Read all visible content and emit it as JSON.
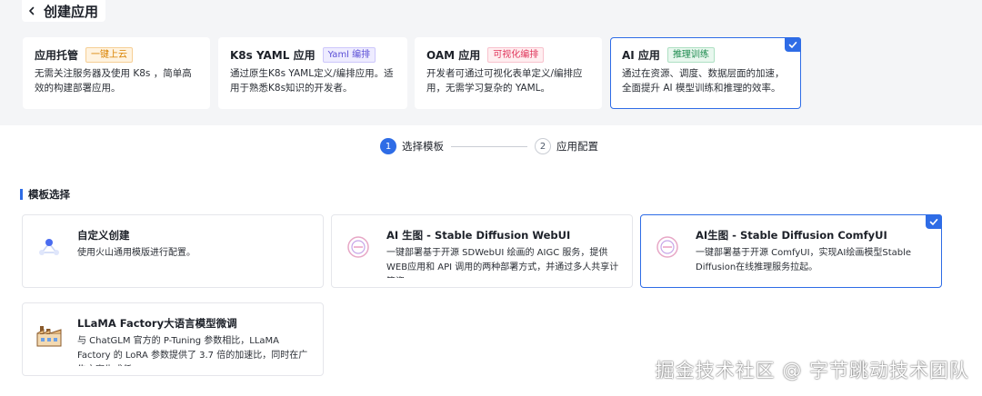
{
  "header": {
    "title": "创建应用"
  },
  "app_types": [
    {
      "name": "应用托管",
      "tag": "一键上云",
      "desc": "无需关注服务器及使用 K8s ，简单高效的构建部署应用。",
      "selected": false
    },
    {
      "name": "K8s YAML 应用",
      "tag": "Yaml 编排",
      "desc": "通过原生K8s YAML定义/编排应用。适用于熟悉K8s知识的开发者。",
      "selected": false
    },
    {
      "name": "OAM 应用",
      "tag": "可视化编排",
      "desc": "开发者可通过可视化表单定义/编排应用，无需学习复杂的 YAML。",
      "selected": false
    },
    {
      "name": "AI 应用",
      "tag": "推理训练",
      "desc": "通过在资源、调度、数据层面的加速，全面提升 AI 模型训练和推理的效率。",
      "selected": true
    }
  ],
  "steps": [
    {
      "num": "1",
      "label": "选择模板",
      "active": true
    },
    {
      "num": "2",
      "label": "应用配置",
      "active": false
    }
  ],
  "section": {
    "title": "模板选择"
  },
  "templates": [
    {
      "name": "自定义创建",
      "desc": "使用火山通用模版进行配置。",
      "icon": "custom-node-icon",
      "selected": false
    },
    {
      "name": "AI 生图 - Stable Diffusion WebUI",
      "desc": "一键部署基于开源 SDWebUI 绘画的 AIGC 服务，提供WEB应用和 API 调用的两种部署方式，并通过多人共享计算资...",
      "icon": "stable-diffusion-icon",
      "selected": false
    },
    {
      "name": "AI生图 - Stable Diffusion ComfyUI",
      "desc": "一键部署基于开源 ComfyUI，实现AI绘画模型Stable Diffusion在线推理服务拉起。",
      "icon": "comfyui-icon",
      "selected": true
    },
    {
      "name": "LLaMA Factory大语言模型微调",
      "desc": "与 ChatGLM 官方的 P-Tuning 参数相比，LLaMA Factory 的 LoRA 参数提供了 3.7 倍的加速比，同时在广告文案生成任...",
      "icon": "llama-factory-icon",
      "selected": false
    }
  ],
  "watermark": "掘金技术社区 @ 字节跳动技术团队",
  "colors": {
    "accent": "#2e6ce6",
    "background_top": "#f4f5f7"
  }
}
